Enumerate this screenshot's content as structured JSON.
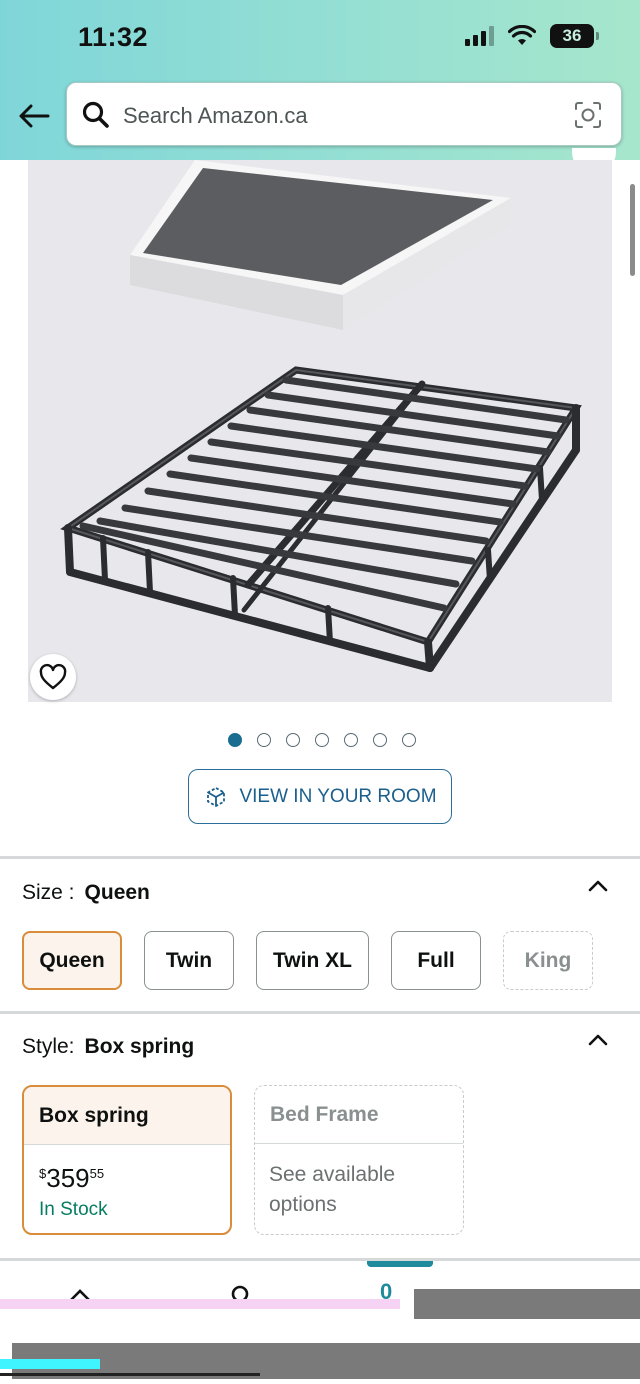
{
  "status_bar": {
    "time": "11:32",
    "battery": "36"
  },
  "search": {
    "placeholder": "Search Amazon.ca"
  },
  "icons": {
    "back": "back-arrow-icon",
    "search": "search-icon",
    "camera": "camera-scan-icon",
    "heart": "heart-icon",
    "ar": "ar-cube-icon",
    "chevron": "chevron-up-icon"
  },
  "gallery": {
    "total_images": 7,
    "active_index": 0
  },
  "view_in_room": {
    "label": "VIEW IN YOUR ROOM"
  },
  "size": {
    "label": "Size :",
    "selected": "Queen",
    "options": [
      {
        "label": "Queen",
        "state": "selected"
      },
      {
        "label": "Twin",
        "state": "available"
      },
      {
        "label": "Twin XL",
        "state": "available"
      },
      {
        "label": "Full",
        "state": "available"
      },
      {
        "label": "King",
        "state": "unavailable"
      }
    ]
  },
  "style": {
    "label": "Style:",
    "selected": "Box spring",
    "options": [
      {
        "label": "Box spring",
        "price_symbol": "$",
        "price_whole": "359",
        "price_fraction": "55",
        "stock": "In Stock"
      },
      {
        "label": "Bed Frame",
        "note": "See available options"
      }
    ]
  },
  "bottom_nav": {
    "cart_count": "0"
  },
  "colors": {
    "accent_teal": "#1f8a9b",
    "selected_orange": "#d98c3a",
    "link_blue": "#1b5f8c",
    "stock_green": "#067d62"
  }
}
